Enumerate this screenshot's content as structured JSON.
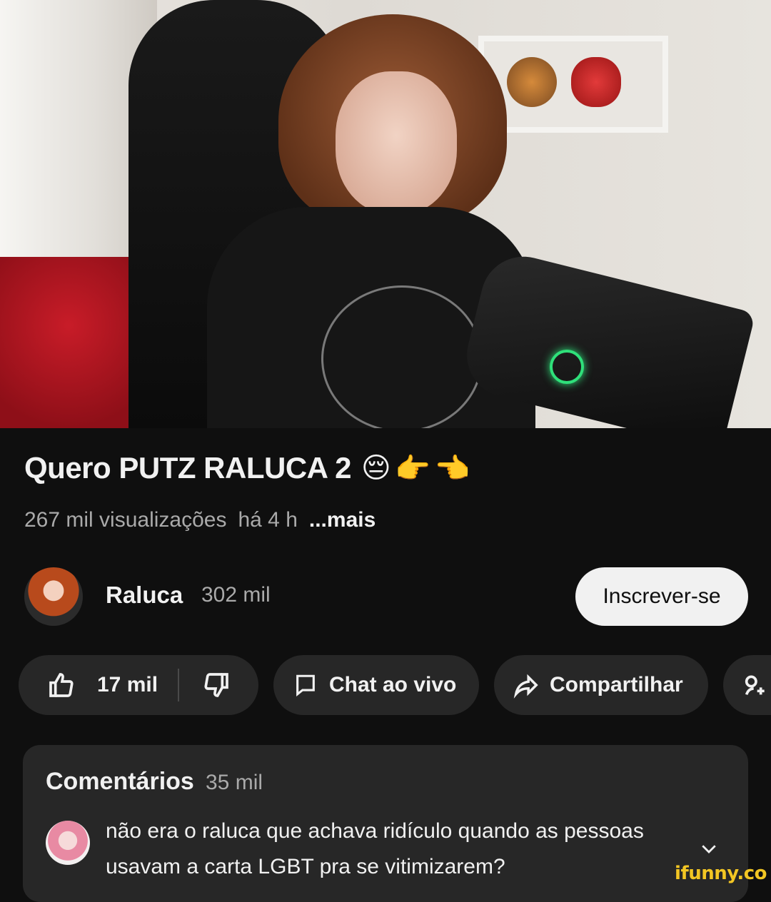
{
  "video": {
    "title": "Quero PUTZ RALUCA 2",
    "title_emojis": [
      "😔",
      "👉",
      "👈"
    ],
    "views": "267 mil visualizações",
    "age": "há 4 h",
    "more": "...mais"
  },
  "channel": {
    "name": "Raluca",
    "subscribers": "302 mil",
    "subscribe_label": "Inscrever-se"
  },
  "actions": {
    "like_count": "17 mil",
    "chat_label": "Chat ao vivo",
    "share_label": "Compartilhar",
    "icons": [
      "thumbs-up-icon",
      "thumbs-down-icon",
      "chat-icon",
      "share-icon",
      "remix-icon"
    ]
  },
  "comments": {
    "title": "Comentários",
    "count": "35 mil",
    "top_comment": "não era o raluca que achava ridículo quando as pessoas usavam a carta LGBT pra se vitimizarem?"
  },
  "watermark": "ifunny.co",
  "colors": {
    "background": "#0f0f0f",
    "pill": "#272727",
    "text_primary": "#f1f1f1",
    "text_secondary": "#aaaaaa",
    "subscribe_bg": "#f1f1f1",
    "watermark": "#f3c623"
  }
}
